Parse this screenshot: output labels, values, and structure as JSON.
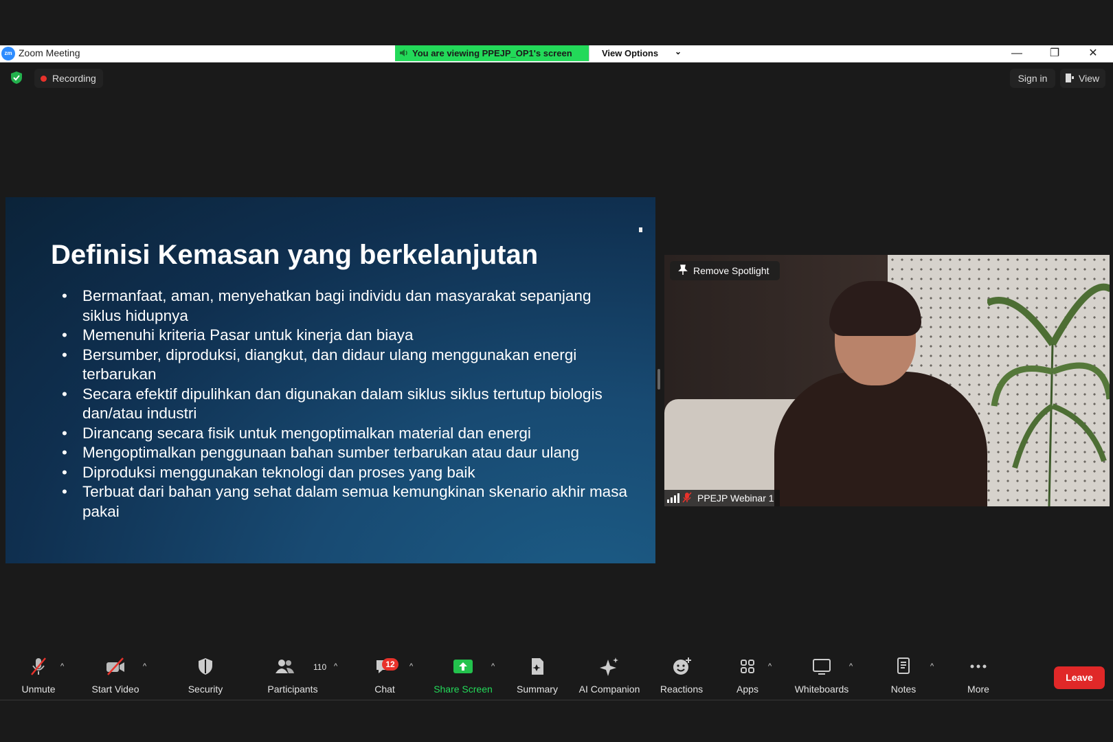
{
  "window": {
    "app_title": "Zoom Meeting",
    "logo_text": "zm",
    "viewing_banner": "You are viewing PPEJP_OP1's screen",
    "view_options_label": "View Options",
    "minimize_glyph": "—",
    "restore_glyph": "❐",
    "close_glyph": "✕"
  },
  "meeting_header": {
    "security_icon": "shield-check-icon",
    "recording_label": "Recording",
    "sign_in_label": "Sign in",
    "view_label": "View"
  },
  "slide": {
    "title": "Definisi Kemasan yang berkelanjutan",
    "bullets": [
      "Bermanfaat, aman, menyehatkan bagi individu dan masyarakat sepanjang siklus hidupnya",
      "Memenuhi kriteria Pasar untuk kinerja dan biaya",
      "Bersumber, diproduksi, diangkut, dan didaur ulang menggunakan energi terbarukan",
      "Secara efektif dipulihkan dan digunakan dalam siklus siklus tertutup biologis dan/atau industri",
      "Dirancang secara fisik untuk mengoptimalkan material dan energi",
      "Mengoptimalkan penggunaan bahan sumber terbarukan atau daur ulang",
      "Diproduksi menggunakan teknologi dan proses yang baik",
      "Terbuat dari bahan yang sehat dalam semua kemungkinan skenario akhir masa pakai"
    ],
    "background_color": "#184a72"
  },
  "video": {
    "remove_spotlight_label": "Remove Spotlight",
    "participant_name": "PPEJP Webinar 1"
  },
  "toolbar": {
    "unmute": "Unmute",
    "start_video": "Start Video",
    "security": "Security",
    "participants": "Participants",
    "participants_count": "110",
    "chat": "Chat",
    "chat_badge": "12",
    "share_screen": "Share Screen",
    "summary": "Summary",
    "ai_companion": "AI Companion",
    "reactions": "Reactions",
    "apps": "Apps",
    "whiteboards": "Whiteboards",
    "notes": "Notes",
    "more": "More",
    "leave": "Leave"
  },
  "colors": {
    "accent_green": "#23d959",
    "leave_red": "#e02828",
    "zoom_blue": "#2d8cff"
  }
}
